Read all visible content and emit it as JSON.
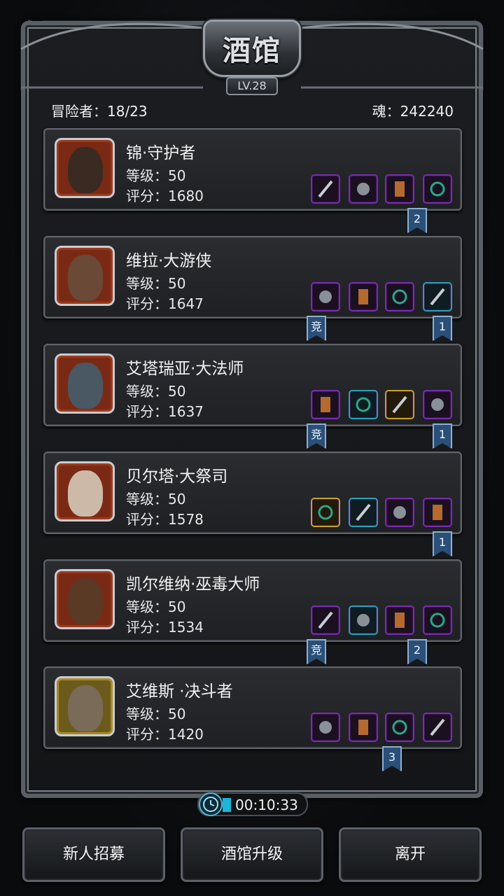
{
  "header": {
    "title": "酒馆",
    "level": "LV.28"
  },
  "stats": {
    "adventurers_label": "冒险者：18/23",
    "souls_label": "魂：242240"
  },
  "heroes": [
    {
      "name": "锦·守护者",
      "level": "等级：50",
      "score": "评分：1680",
      "stars": "★★★★",
      "frame": "red",
      "gear": [
        "purple",
        "purple",
        "purple",
        "purple"
      ],
      "tags": [
        {
          "text": "2"
        }
      ]
    },
    {
      "name": "维拉·大游侠",
      "level": "等级：50",
      "score": "评分：1647",
      "stars": "★★★★",
      "frame": "red",
      "gear": [
        "purple",
        "purple",
        "purple",
        "blue"
      ],
      "tags": [
        {
          "text": "竞"
        },
        {
          "text": "1"
        }
      ]
    },
    {
      "name": "艾塔瑞亚·大法师",
      "level": "等级：50",
      "score": "评分：1637",
      "stars": "★★★★",
      "frame": "red",
      "gear": [
        "purple",
        "blue",
        "gold",
        "purple"
      ],
      "tags": [
        {
          "text": "竞"
        },
        {
          "text": "1"
        }
      ]
    },
    {
      "name": "贝尔塔·大祭司",
      "level": "等级：50",
      "score": "评分：1578",
      "stars": "★★★★",
      "frame": "red",
      "gear": [
        "gold",
        "blue",
        "purple",
        "purple"
      ],
      "tags": [
        {
          "text": "1"
        }
      ]
    },
    {
      "name": "凯尔维纳·巫毒大师",
      "level": "等级：50",
      "score": "评分：1534",
      "stars": "★★★★",
      "frame": "red",
      "gear": [
        "purple",
        "blue",
        "purple",
        "purple"
      ],
      "tags": [
        {
          "text": "竞"
        },
        {
          "text": "2"
        }
      ]
    },
    {
      "name": "艾维斯 ·决斗者",
      "level": "等级：50",
      "score": "评分：1420",
      "stars": "★★★★",
      "frame": "gold",
      "gear": [
        "purple",
        "purple",
        "purple",
        "purple"
      ],
      "tags": [
        {
          "text": "3"
        }
      ]
    }
  ],
  "timer": {
    "text": "00:10:33"
  },
  "buttons": {
    "recruit": "新人招募",
    "upgrade": "酒馆升级",
    "leave": "离开"
  }
}
